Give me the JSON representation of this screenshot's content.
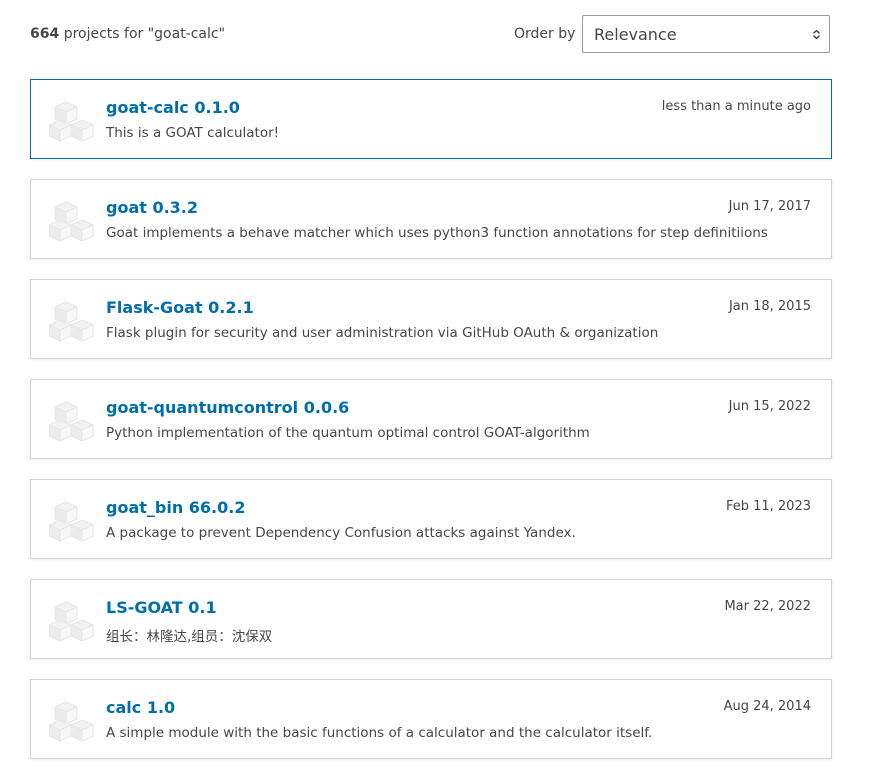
{
  "summary": {
    "count": "664",
    "text": "projects for \"goat-calc\""
  },
  "order": {
    "label": "Order by",
    "selected": "Relevance"
  },
  "colors": {
    "link": "#006dad",
    "text": "#464646",
    "card_border": "#d3d3d3",
    "selected_border": "#006dad"
  },
  "results": [
    {
      "name": "goat-calc 0.1.0",
      "date": "less than a minute ago",
      "description": "This is a GOAT calculator!",
      "icon": "package-cubes-icon"
    },
    {
      "name": "goat 0.3.2",
      "date": "Jun 17, 2017",
      "description": "Goat implements a behave matcher which uses python3 function annotations for step definitiions",
      "icon": "package-cubes-icon"
    },
    {
      "name": "Flask-Goat 0.2.1",
      "date": "Jan 18, 2015",
      "description": "Flask plugin for security and user administration via GitHub OAuth & organization",
      "icon": "package-cubes-icon"
    },
    {
      "name": "goat-quantumcontrol 0.0.6",
      "date": "Jun 15, 2022",
      "description": "Python implementation of the quantum optimal control GOAT-algorithm",
      "icon": "package-cubes-icon"
    },
    {
      "name": "goat_bin 66.0.2",
      "date": "Feb 11, 2023",
      "description": "A package to prevent Dependency Confusion attacks against Yandex.",
      "icon": "package-cubes-icon"
    },
    {
      "name": "LS-GOAT 0.1",
      "date": "Mar 22, 2022",
      "description": "组长：林隆达,组员：沈保双",
      "icon": "package-cubes-icon"
    },
    {
      "name": "calc 1.0",
      "date": "Aug 24, 2014",
      "description": "A simple module with the basic functions of a calculator and the calculator itself.",
      "icon": "package-cubes-icon"
    }
  ]
}
